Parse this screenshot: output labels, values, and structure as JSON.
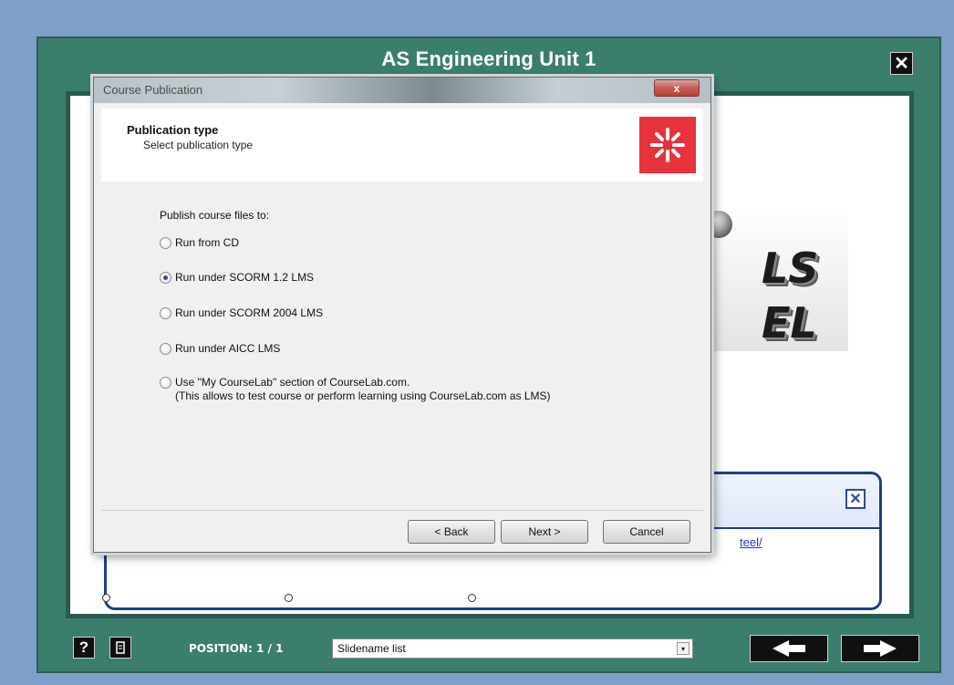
{
  "player": {
    "title": "AS Engineering Unit 1",
    "close_label": "✕"
  },
  "info_box": {
    "link_text": "teel/",
    "close_label": "✕"
  },
  "dialog": {
    "title": "Course Publication",
    "close_label": "x",
    "header_title": "Publication type",
    "header_subtitle": "Select publication type",
    "publish_label": "Publish course files to:",
    "options": [
      {
        "label": "Run from CD",
        "checked": false
      },
      {
        "label": "Run under SCORM 1.2 LMS",
        "checked": true
      },
      {
        "label": "Run under SCORM 2004 LMS",
        "checked": false
      },
      {
        "label": "Run under AICC LMS",
        "checked": false
      },
      {
        "label": "Use \"My CourseLab\" section of CourseLab.com.",
        "label_line2": "(This allows to test course or perform learning using CourseLab.com as LMS)",
        "checked": false
      }
    ],
    "buttons": {
      "back": "< Back",
      "next": "Next >",
      "cancel": "Cancel"
    }
  },
  "toolbar": {
    "help_label": "?",
    "notes_label": "▯",
    "position_text": "POSITION: 1 / 1",
    "slide_select_value": "Slidename list",
    "slide_select_arrow": "▾"
  },
  "icons": {
    "logo": "asterisk-logo-icon",
    "prev": "arrow-left-icon",
    "next": "arrow-right-icon"
  },
  "colors": {
    "frame": "#3c7e6e",
    "logo_red": "#e8323c",
    "link": "#1a43b5"
  }
}
